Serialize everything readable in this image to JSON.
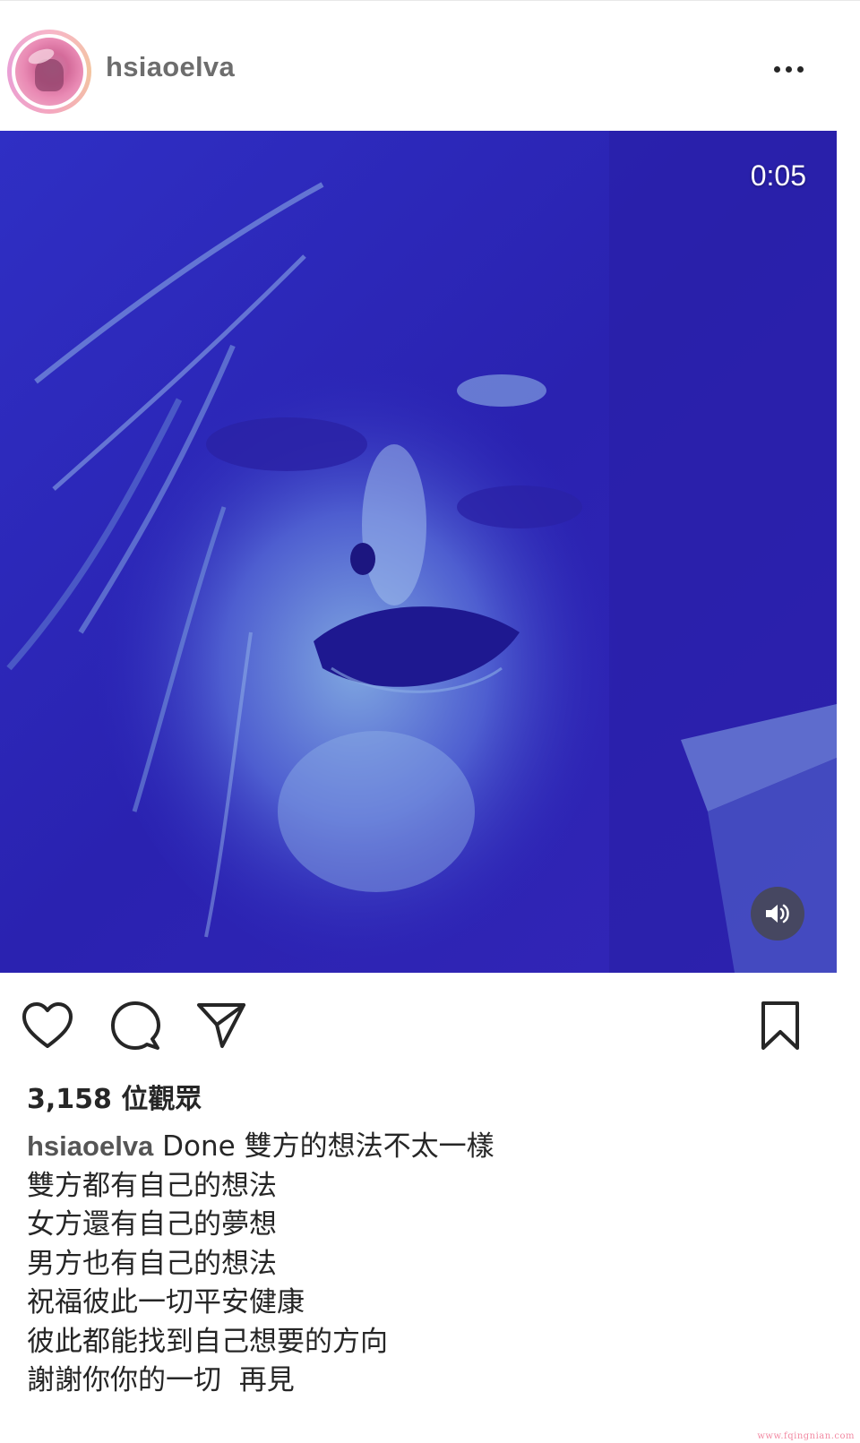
{
  "header": {
    "username": "hsiaoelva",
    "avatar_icon": "profile-photo"
  },
  "video": {
    "timestamp": "0:05",
    "volume_icon": "volume-on-icon",
    "tint_color": "#2a25b8"
  },
  "actions": {
    "like_icon": "heart-icon",
    "comment_icon": "comment-bubble-icon",
    "share_icon": "paper-plane-icon",
    "save_icon": "bookmark-icon"
  },
  "views": "3,158 位觀眾",
  "caption": {
    "username": "hsiaoelva",
    "first_line_text": " Done 雙方的想法不太一樣",
    "lines": [
      "雙方都有自己的想法",
      "女方還有自己的夢想",
      "男方也有自己的想法",
      "祝福彼此一切平安健康",
      "彼此都能找到自己想要的方向",
      "謝謝你你的一切  再見"
    ]
  },
  "watermark": "www.fqingnian.com"
}
